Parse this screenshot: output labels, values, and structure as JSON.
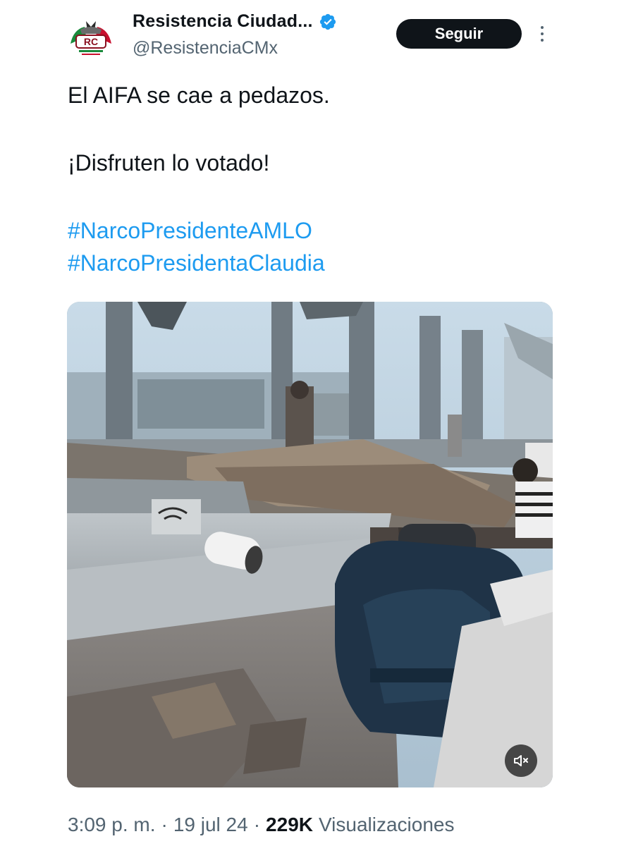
{
  "author": {
    "display_name": "Resistencia Ciudad...",
    "handle": "@ResistenciaCMx",
    "avatar_initials": "RC",
    "verified_color": "#1d9bf0"
  },
  "actions": {
    "follow_label": "Seguir"
  },
  "tweet": {
    "line1": "El AIFA se cae a pedazos.",
    "line2": "¡Disfruten lo votado!",
    "hashtags": [
      "#NarcoPresidenteAMLO",
      "#NarcoPresidentaClaudia"
    ]
  },
  "media": {
    "type": "video",
    "mute_icon": "speaker-muted-icon"
  },
  "meta": {
    "time": "3:09 p. m.",
    "separator": "·",
    "date": "19 jul 24",
    "views_count": "229K",
    "views_label": "Visualizaciones"
  },
  "colors": {
    "text": "#0f1419",
    "secondary": "#536471",
    "link": "#1d9bf0",
    "button_bg": "#0f1419"
  }
}
